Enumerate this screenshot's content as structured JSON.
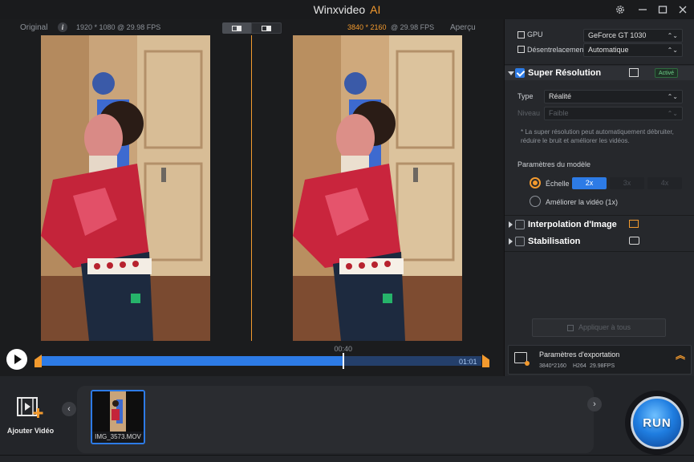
{
  "app": {
    "title": "Winxvideo",
    "title_accent": "AI",
    "accent_color": "#f39a2e",
    "highlight_color": "#2d7be6"
  },
  "window_controls": {
    "settings": "gear-icon",
    "minimize": "minimize-icon",
    "maximize": "maximize-icon",
    "close": "close-icon"
  },
  "preview": {
    "original_label": "Original",
    "original_info": "1920 * 1080 @ 29.98 FPS",
    "output_resolution": "3840 * 2160",
    "output_fps": "@ 29.98 FPS",
    "preview_label": "Aperçu"
  },
  "timeline": {
    "current_time": "00:40",
    "end_time": "01:01",
    "progress": 0.687
  },
  "bottom": {
    "add_video_label": "Ajouter Vidéo",
    "thumbnail_name": "IMG_3573.MOV",
    "run_label": "RUN"
  },
  "panel": {
    "gpu_label": "GPU",
    "gpu_value": "GeForce GT 1030",
    "deinterlace_label": "Désentrelacement",
    "deinterlace_value": "Automatique",
    "super_res": {
      "title": "Super Résolution",
      "badge": "Activé",
      "enabled": true,
      "type_label": "Type",
      "type_value": "Réalité",
      "level_label": "Niveau",
      "level_value": "Faible",
      "note": "* La super résolution peut automatiquement débruiter, réduire le bruit et améliorer les vidéos.",
      "model_params_label": "Paramètres du modèle",
      "scale_label": "Échelle",
      "scales": [
        "2x",
        "3x",
        "4x"
      ],
      "selected_scale": "2x",
      "enhance_label": "Améliorer la vidéo (1x)"
    },
    "interpolation": {
      "title": "Interpolation d'Image",
      "enabled": false
    },
    "stabilization": {
      "title": "Stabilisation",
      "enabled": false
    },
    "apply_all_label": "Appliquer à tous",
    "export": {
      "title": "Paramètres d'exportation",
      "resolution": "3840*2160",
      "codec": "H264",
      "fps": "29.98FPS"
    }
  }
}
